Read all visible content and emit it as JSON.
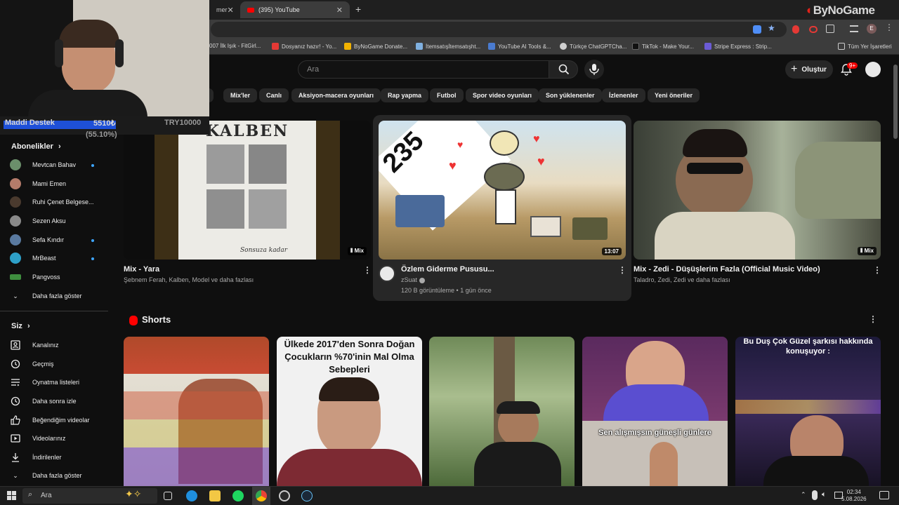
{
  "browser": {
    "tabs": [
      {
        "label": "mer"
      },
      {
        "label": "(395) YouTube"
      }
    ],
    "new_tab": "+",
    "bookmarks": [
      "007 İlk Işık - FitGirl...",
      "Dosyanız hazır! - Yo...",
      "ByNoGame Donate...",
      "İtemsatışİtemsatışht...",
      "YouTube AI Tools &...",
      "Türkçe ChatGPTCha...",
      "TikTok - Make Your...",
      "Stripe Express : Strip...",
      "Tüm Yer İşaretleri"
    ]
  },
  "overlay": {
    "brand": "ByNoGame",
    "donation_label": "Maddi Destek",
    "donation_amount": "5510₺",
    "donation_goal": "TRY10000",
    "donation_percent_text": "(55.10%)",
    "donation_progress": 0.551
  },
  "header": {
    "search_placeholder": "Ara",
    "create_label": "Oluştur",
    "notifications_badge": "9+"
  },
  "chips": [
    "n",
    "Mix'ler",
    "Canlı",
    "Aksiyon-macera oyunları",
    "Rap yapma",
    "Futbol",
    "Spor video oyunları",
    "Son yüklenenler",
    "İzlenenler",
    "Yeni öneriler"
  ],
  "sidebar": {
    "subscriptions_title": "Abonelikler",
    "subscriptions": [
      {
        "name": "Mevtcan Bahav",
        "new": true,
        "color": "#6b8f6b"
      },
      {
        "name": "Mami Emen",
        "new": false,
        "color": "#b47b6a"
      },
      {
        "name": "Ruhi Çenet Belgese...",
        "new": false,
        "color": "#4a3a2e"
      },
      {
        "name": "Sezen Aksu",
        "new": false,
        "color": "#8a8a8a"
      },
      {
        "name": "Sefa Kındır",
        "new": true,
        "color": "#5a7aa0"
      },
      {
        "name": "MrBeast",
        "new": true,
        "color": "#2ea0c8"
      },
      {
        "name": "Pangvoss",
        "new": false,
        "color": "#3e8e3e"
      }
    ],
    "show_more_subs": "Daha fazla göster",
    "you_title": "Siz",
    "you_items": [
      {
        "label": "Kanalınız",
        "icon": "channel-icon"
      },
      {
        "label": "Geçmiş",
        "icon": "history-icon"
      },
      {
        "label": "Oynatma listeleri",
        "icon": "playlists-icon"
      },
      {
        "label": "Daha sonra izle",
        "icon": "watch-later-icon"
      },
      {
        "label": "Beğendiğim videolar",
        "icon": "like-icon"
      },
      {
        "label": "Videolarınız",
        "icon": "your-videos-icon"
      },
      {
        "label": "İndirilenler",
        "icon": "downloads-icon"
      },
      {
        "label": "Daha fazla göster",
        "icon": "chevron-down-icon"
      }
    ]
  },
  "videos": [
    {
      "title": "Mix - Yara",
      "meta1": "Şebnem Ferah, Kalben, Model ve daha fazlası",
      "meta2": "",
      "badge": "Mix",
      "thumb_text": "KALBEN",
      "thumb_caption": "Sonsuza kadar"
    },
    {
      "title": "Özlem Giderme Pususu...",
      "meta1": "zSuat",
      "meta2": "120 B görüntüleme • 1 gün önce",
      "badge": "13:07",
      "thumb_text": "235"
    },
    {
      "title": "Mix - Zedi - Düşüşlerim Fazla (Official Music Video)",
      "meta1": "Taladro, Zedi, Zedi ve daha fazlası",
      "meta2": "",
      "badge": "Mix"
    }
  ],
  "shorts": {
    "title": "Shorts",
    "items": [
      {
        "overlay": ""
      },
      {
        "overlay": "Ülkede 2017'den Sonra Doğan Çocukların %70'inin Mal Olma Sebepleri"
      },
      {
        "overlay": ""
      },
      {
        "overlay": "Sen alışmışsın güneşli günlere"
      },
      {
        "overlay": "Bu Duş Çok Güzel şarkısı hakkında konuşuyor :"
      }
    ]
  },
  "taskbar": {
    "search_label": "Ara",
    "time": "02:34",
    "date": "5.08.2026"
  }
}
